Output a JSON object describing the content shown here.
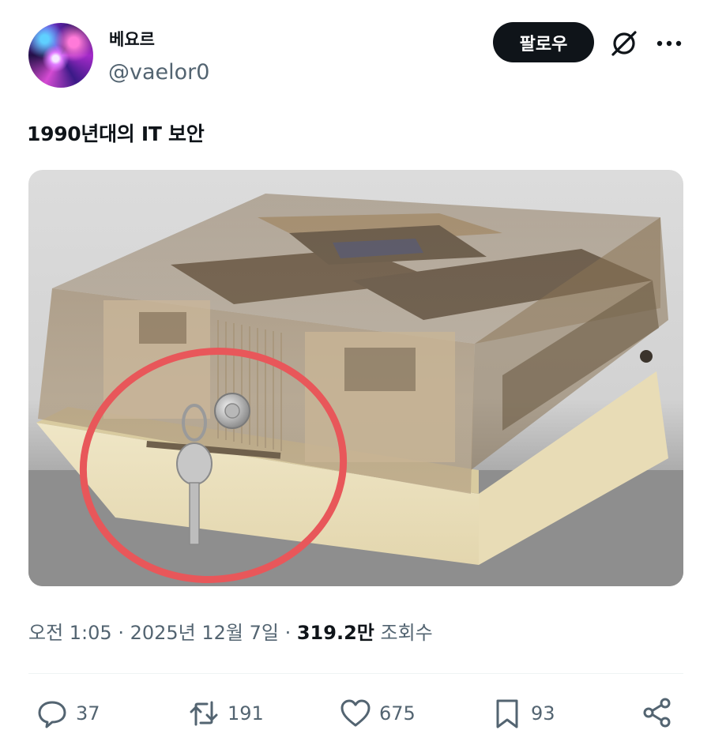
{
  "author": {
    "display_name": "베요르",
    "handle": "@vaelor0"
  },
  "header": {
    "follow_label": "팔로우",
    "grok_icon": "grok-icon",
    "more_icon": "more-icon"
  },
  "post": {
    "text": "1990년대의 IT 보안",
    "media": {
      "icon": "floppy-disk-lock-box-photo"
    },
    "meta": {
      "time": "오전 1:05",
      "separator": " · ",
      "date": "2025년 12월 7일",
      "views_count": "319.2만",
      "views_label": "조회수"
    }
  },
  "actions": {
    "replies": "37",
    "reposts": "191",
    "likes": "675",
    "bookmarks": "93"
  },
  "colors": {
    "primary_text": "#0f1419",
    "secondary_text": "#536471",
    "follow_button_bg": "#0f1419",
    "annotation_circle": "#e8575a"
  }
}
